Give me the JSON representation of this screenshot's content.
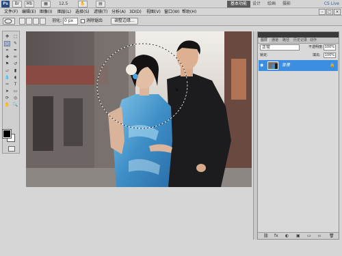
{
  "appbar": {
    "logo": "Ps",
    "zoom": "12.5",
    "workspaces": [
      "基本功能",
      "设计",
      "绘画",
      "摄影"
    ],
    "active_workspace": "基本功能",
    "cs_live": "CS Live"
  },
  "menu": [
    "文件(F)",
    "编辑(E)",
    "图像(I)",
    "图层(L)",
    "选择(S)",
    "滤镜(T)",
    "分析(A)",
    "3D(D)",
    "视图(V)",
    "窗口(W)",
    "帮助(H)"
  ],
  "window_controls": [
    "–",
    "□",
    "×"
  ],
  "options": {
    "feather_label": "羽化:",
    "feather_value": "0 px",
    "antialias_label": "消除锯齿",
    "refine_button": "调整边缘..."
  },
  "layers_panel": {
    "tabs": [
      "图层",
      "通道",
      "路径",
      "历史记录",
      "动作"
    ],
    "active_tab": "图层",
    "blend_mode": "正常",
    "opacity_label": "不透明度:",
    "opacity_value": "100%",
    "lock_label": "锁定:",
    "fill_label": "填充:",
    "fill_value": "100%",
    "layer_name": "背景",
    "eye_icon": "◉",
    "lock_icon": "🔒"
  },
  "footer_icons": [
    "⛓",
    "fx",
    "◐",
    "▣",
    "▭",
    "▫",
    "🗑"
  ],
  "colors": {
    "selection_accent": "#3c8ee0",
    "foreground": "#000000",
    "background": "#ffffff"
  }
}
